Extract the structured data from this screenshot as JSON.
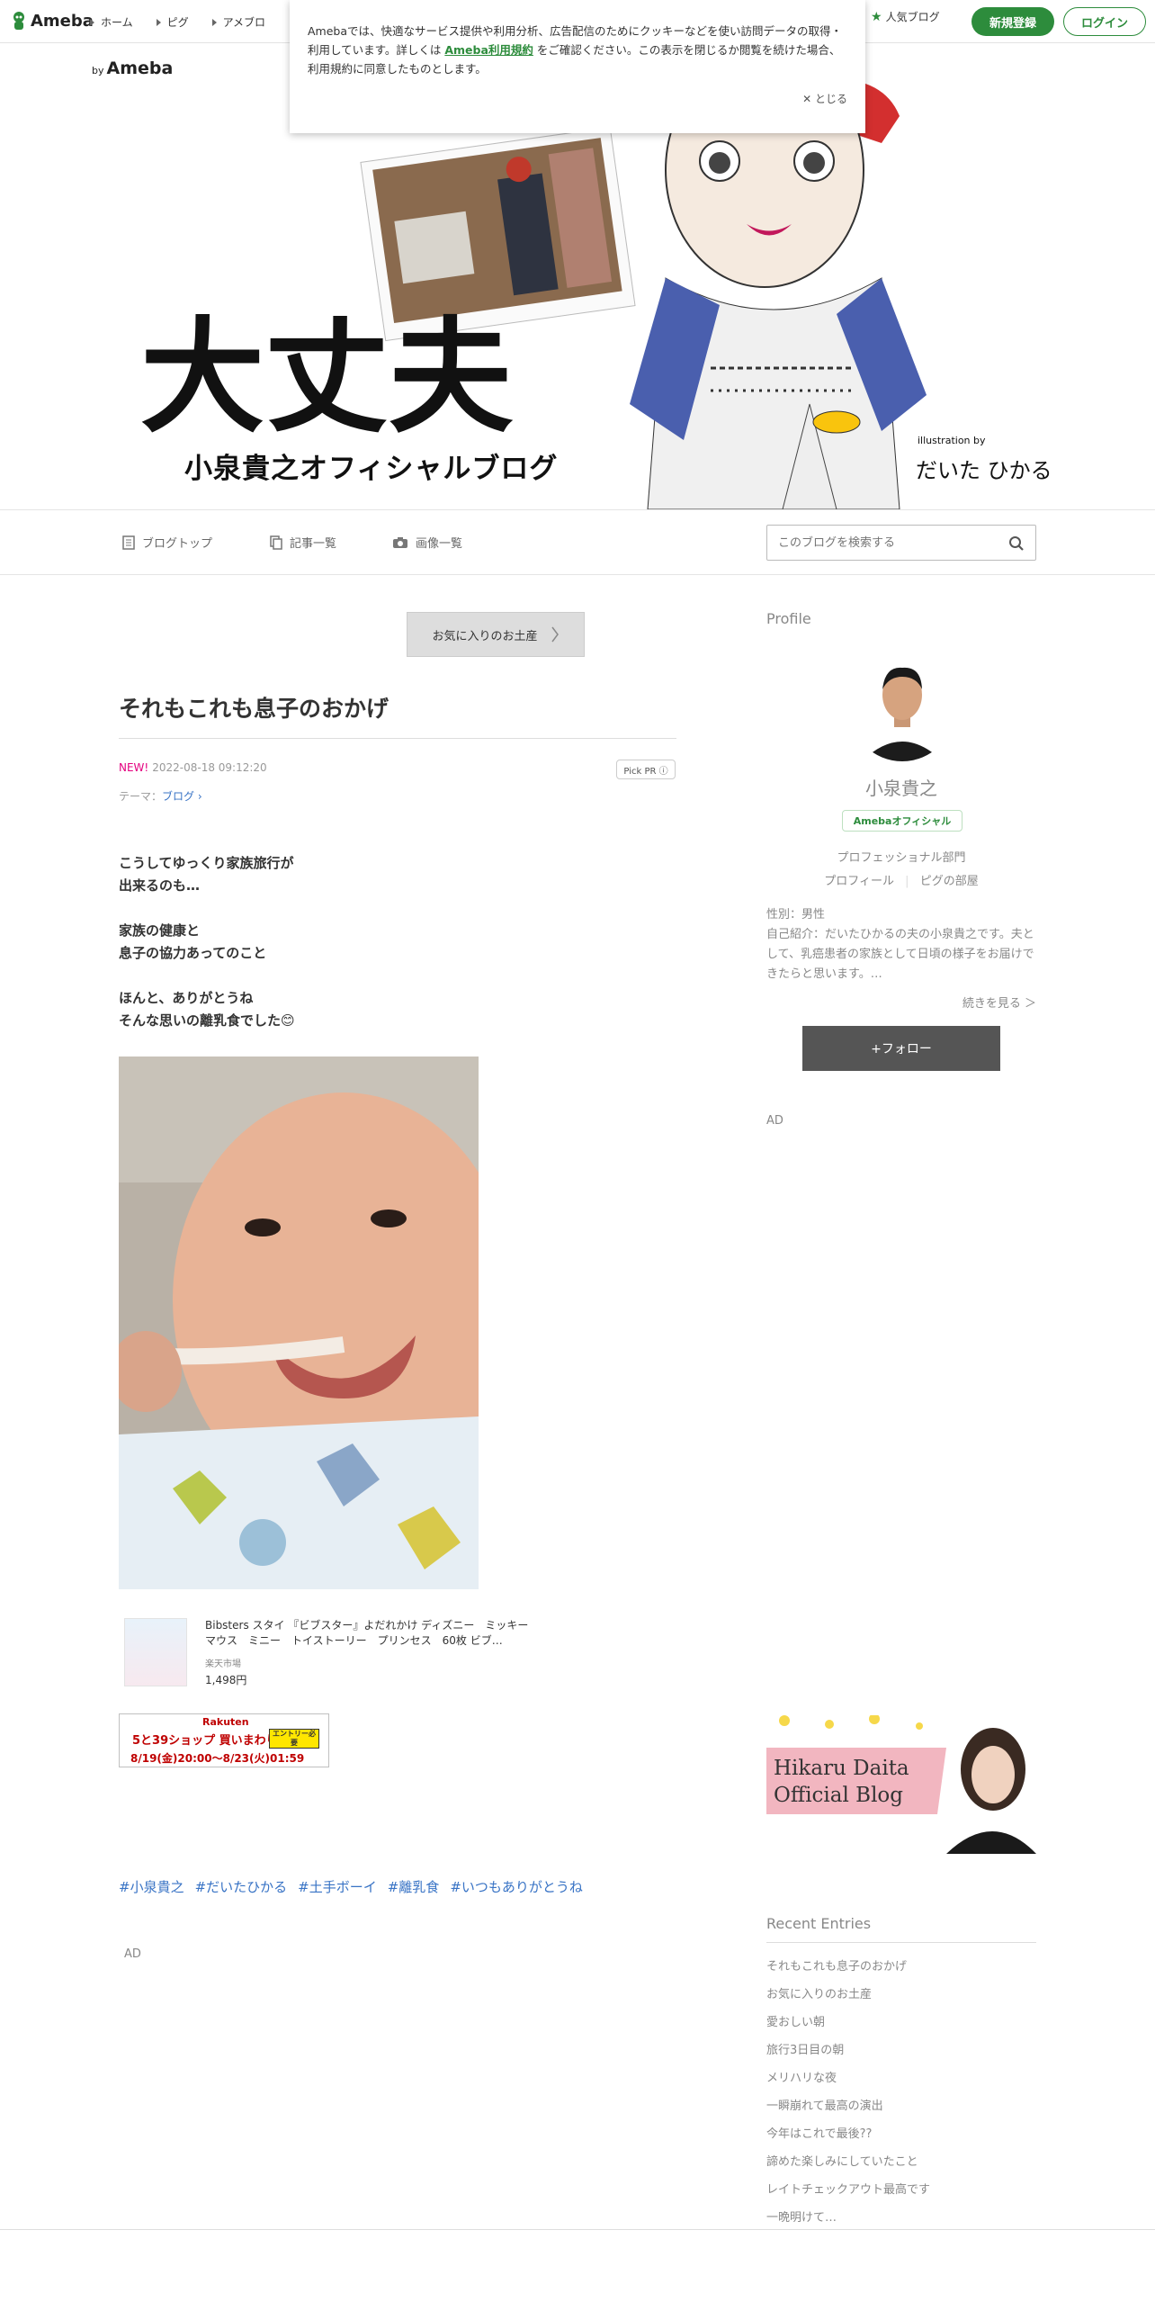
{
  "header": {
    "logo_text": "Ameba",
    "nav": [
      "ホーム",
      "ピグ",
      "アメブロ"
    ],
    "popular": "人気ブログ",
    "register": "新規登録",
    "login": "ログイン"
  },
  "cookie": {
    "text_before": "Amebaでは、快適なサービス提供や利用分析、広告配信のためにクッキーなどを使い訪問データの取得・利用しています。詳しくは ",
    "link": "Ameba利用規約",
    "text_after": " をご確認ください。この表示を閉じるか閲覧を続けた場合、利用規約に同意したものとします。",
    "close": "とじる"
  },
  "banner": {
    "by": "by",
    "brand": "Ameba",
    "title": "大丈夫",
    "subtitle": "小泉貴之オフィシャルブログ",
    "illustration_by": "illustration by",
    "signature": "だいた ひかる"
  },
  "blognav": {
    "top": "ブログトップ",
    "entries": "記事一覧",
    "images": "画像一覧",
    "search_placeholder": "このブログを検索する"
  },
  "article": {
    "prev_button": "お気に入りのお土産",
    "title": "それもこれも息子のおかげ",
    "new_label": "NEW!",
    "date": "2022-08-18 09:12:20",
    "pickpr": "Pick PR ⓘ",
    "theme_label": "テーマ：",
    "theme": "ブログ",
    "body": "こうしてゆっくり家族旅行が\n出来るのも…\n\n家族の健康と\n息子の協力あってのこと\n\nほんと、ありがとうね\nそんな思いの離乳食でした😊",
    "product_title": "Bibsters スタイ 『ビブスター』よだれかけ ディズニー　ミッキーマウス　ミニー　トイストーリー　プリンセス　60枚 ビブ…",
    "product_shop": "楽天市場",
    "product_price": "1,498円",
    "rakuten_logo": "Rakuten",
    "rakuten_event": "5と39ショップ 買いまわり",
    "rakuten_entry": "エントリー必要",
    "rakuten_dates": "8/19(金)20:00～8/23(火)01:59",
    "tags": [
      "#小泉貴之",
      "#だいたひかる",
      "#土手ボーイ",
      "#離乳食",
      "#いつもありがとうね"
    ],
    "ad": "AD"
  },
  "sidebar": {
    "profile_heading": "Profile",
    "name": "小泉貴之",
    "badge": "Amebaオフィシャル",
    "category": "プロフェッショナル部門",
    "profile_link": "プロフィール",
    "pig_link": "ピグの部屋",
    "desc": "性別：男性\n自己紹介：だいたひかるの夫の小泉貴之です。夫として、乳癌患者の家族として日頃の様子をお届けできたらと思います。…",
    "more": "続きを見る ＞",
    "follow": "+フォロー",
    "ad": "AD",
    "hikaru_line1": "Hikaru Daita",
    "hikaru_line2": "Official Blog",
    "recent_heading": "Recent Entries",
    "recent": [
      "それもこれも息子のおかげ",
      "お気に入りのお土産",
      "愛おしい朝",
      "旅行3日目の朝",
      "メリハリな夜",
      "一瞬崩れて最高の演出",
      "今年はこれで最後??",
      "諦めた楽しみにしていたこと",
      "レイトチェックアウト最高です",
      "一晩明けて…"
    ]
  }
}
